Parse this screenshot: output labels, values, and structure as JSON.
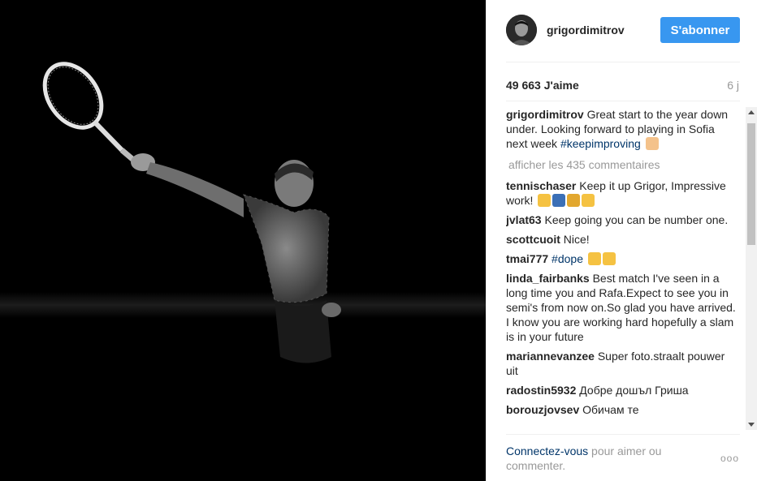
{
  "header": {
    "username": "grigordimitrov",
    "follow_label": "S'abonner"
  },
  "stats": {
    "likes": "49 663 J'aime",
    "time": "6 j"
  },
  "caption": {
    "author": "grigordimitrov",
    "text": "Great start to the year down under. Looking forward to playing in Sofia next week ",
    "hashtag": "#keepimproving"
  },
  "comments_link": "afficher les 435 commentaires",
  "comments": [
    {
      "author": "tennischaser",
      "text": "Keep it up Grigor, Impressive work! "
    },
    {
      "author": "jvlat63",
      "text": "Keep going you can be number one."
    },
    {
      "author": "scottcuoit",
      "text": "Nice!"
    },
    {
      "author": "tmai777",
      "hashtag": "#dope"
    },
    {
      "author": "linda_fairbanks",
      "text": "Best match I've seen in a long time you and Rafa.Expect to see you in semi's from now on.So glad you have arrived. I know you are working hard hopefully a slam is in your future"
    },
    {
      "author": "mariannevanzee",
      "text": "Super foto.straalt pouwer uit"
    },
    {
      "author": "radostin5932",
      "text": "Добре дошъл Гриша"
    },
    {
      "author": "borouzjovsev",
      "text": "Обичам те"
    }
  ],
  "footer": {
    "login_link": "Connectez-vous",
    "login_text": " pour aimer ou commenter.",
    "more_label": "ooo"
  },
  "colors": {
    "accent": "#3897f0",
    "hashtag": "#003569",
    "muted": "#999999"
  }
}
